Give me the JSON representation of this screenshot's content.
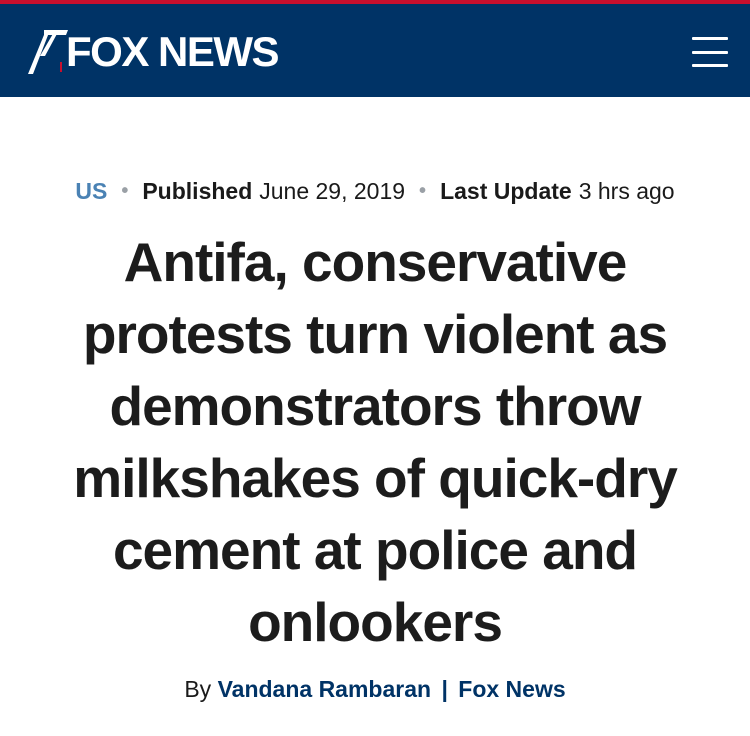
{
  "header": {
    "logo_text": "FOX NEWS",
    "menu_icon": "hamburger-menu-icon",
    "colors": {
      "bar": "#003366",
      "accent": "#c8102e"
    }
  },
  "article": {
    "category": "US",
    "published_label": "Published",
    "published_date": "June 29, 2019",
    "updated_label": "Last Update",
    "updated_value": "3 hrs ago",
    "headline": "Antifa, conservative protests turn violent as demonstrators throw milkshakes of quick-dry cement at police and onlookers",
    "byline_prefix": "By",
    "author": "Vandana Rambaran",
    "byline_separator": "|",
    "source": "Fox News"
  }
}
